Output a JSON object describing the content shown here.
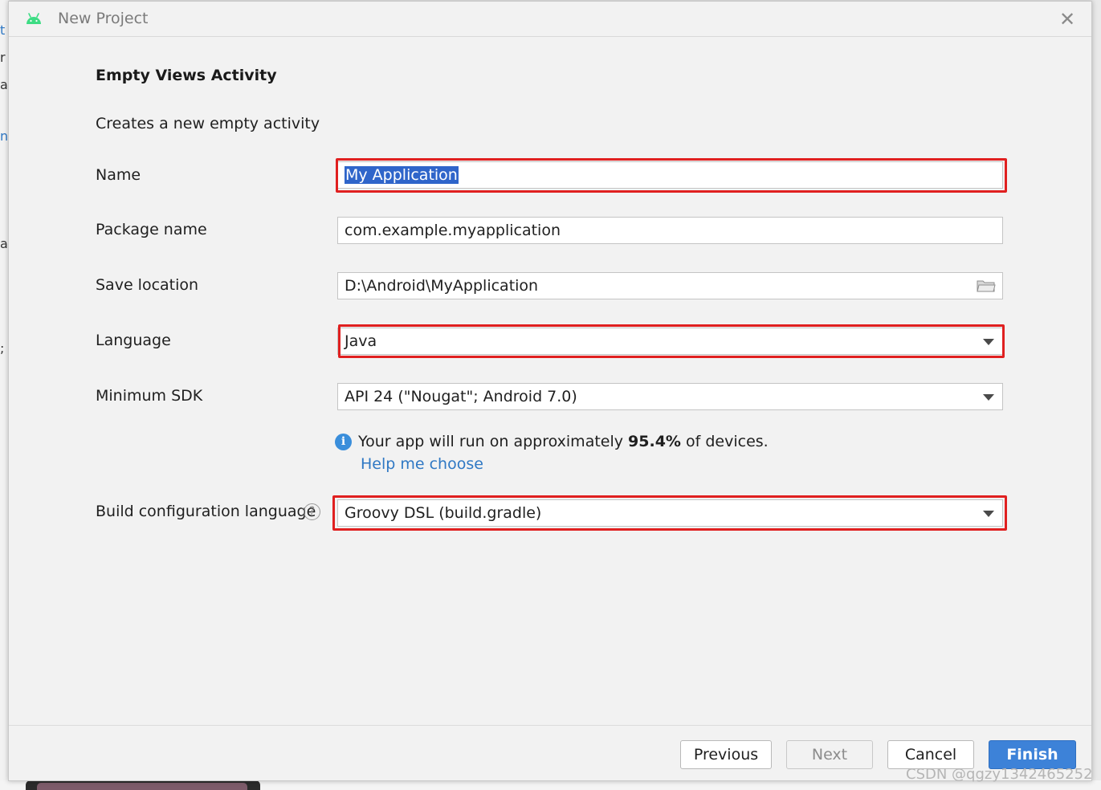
{
  "dialog": {
    "title": "New Project",
    "heading": "Empty Views Activity",
    "description": "Creates a new empty activity"
  },
  "form": {
    "name_label": "Name",
    "name_value": "My Application",
    "package_label": "Package name",
    "package_value": "com.example.myapplication",
    "save_label": "Save location",
    "save_value": "D:\\Android\\MyApplication",
    "language_label": "Language",
    "language_value": "Java",
    "min_sdk_label": "Minimum SDK",
    "min_sdk_value": "API 24 (\"Nougat\"; Android 7.0)",
    "info_prefix": "Your app will run on approximately ",
    "info_percent": "95.4%",
    "info_suffix": " of devices.",
    "help_link": "Help me choose",
    "build_label": "Build configuration language",
    "build_value": "Groovy DSL (build.gradle)"
  },
  "buttons": {
    "previous": "Previous",
    "next": "Next",
    "cancel": "Cancel",
    "finish": "Finish"
  },
  "watermark": "CSDN @qgzy1342465252",
  "icons": {
    "title": "android-icon",
    "close": "close-icon",
    "folder": "folder-icon",
    "info": "info-icon",
    "help": "help-icon",
    "dropdown": "chevron-down-icon"
  },
  "colors": {
    "highlight_border": "#e02020",
    "selection": "#2f65ca",
    "link": "#2f78c4",
    "primary_button": "#3d82d8"
  }
}
